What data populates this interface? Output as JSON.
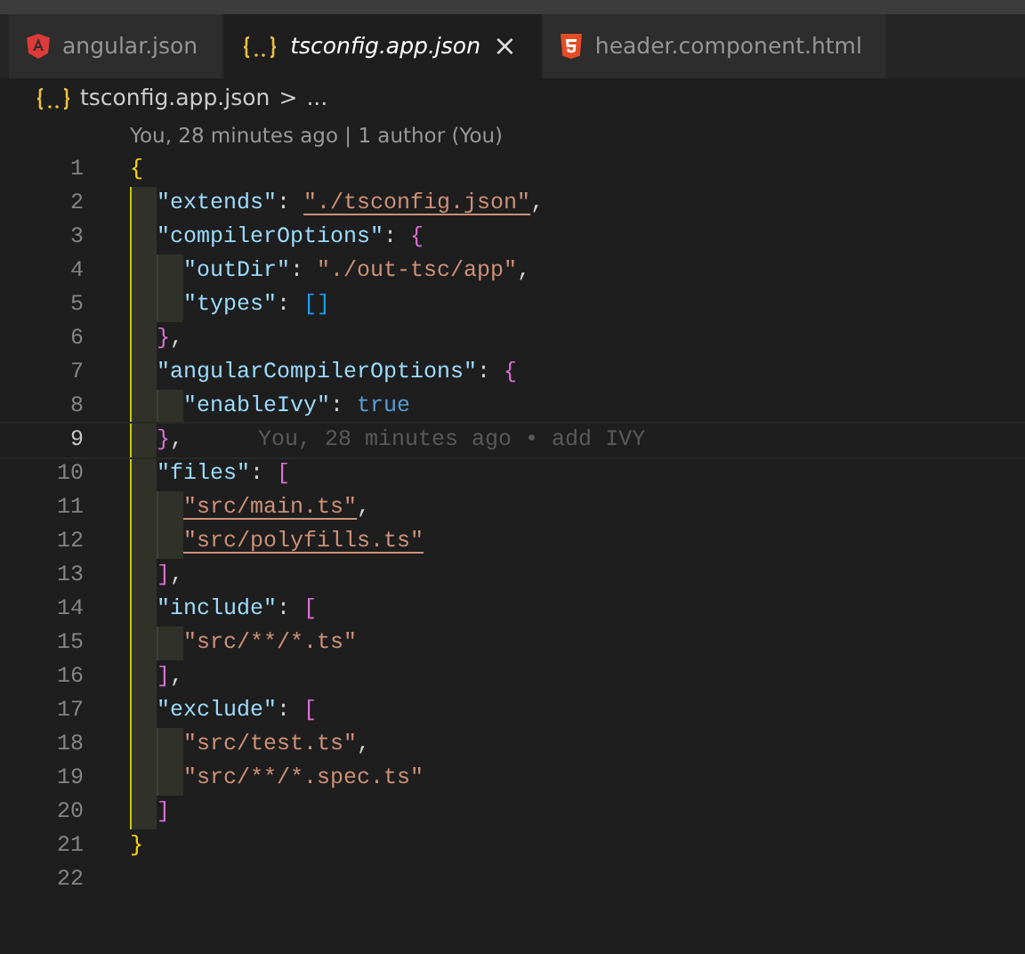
{
  "tabs": [
    {
      "label": "angular.json",
      "kind": "angular",
      "selected": false
    },
    {
      "label": "tsconfig.app.json",
      "kind": "json",
      "selected": true,
      "close": "×"
    },
    {
      "label": "header.component.html",
      "kind": "html",
      "selected": false
    }
  ],
  "breadcrumb": {
    "file": "tsconfig.app.json",
    "separator": ">",
    "more": "..."
  },
  "codelens": "You, 28 minutes ago | 1 author (You)",
  "lines": [
    {
      "number": "1",
      "current": false,
      "tokens": [
        {
          "kind": "bracket",
          "text": "{",
          "color": "#ffd700"
        }
      ]
    },
    {
      "number": "2",
      "current": false,
      "tokens": [
        {
          "kind": "key",
          "text": "  \"extends\""
        },
        {
          "kind": "punct",
          "text": ": "
        },
        {
          "kind": "string",
          "text": "\"./tsconfig.json\"",
          "underline": true
        },
        {
          "kind": "punct",
          "text": ","
        }
      ]
    },
    {
      "number": "3",
      "current": false,
      "tokens": [
        {
          "kind": "key",
          "text": "  \"compilerOptions\""
        },
        {
          "kind": "punct",
          "text": ": "
        },
        {
          "kind": "bracket",
          "text": "{",
          "color": "#da70d6"
        }
      ]
    },
    {
      "number": "4",
      "current": false,
      "tokens": [
        {
          "kind": "key",
          "text": "    \"outDir\""
        },
        {
          "kind": "punct",
          "text": ": "
        },
        {
          "kind": "string",
          "text": "\"./out-tsc/app\""
        },
        {
          "kind": "punct",
          "text": ","
        }
      ]
    },
    {
      "number": "5",
      "current": false,
      "tokens": [
        {
          "kind": "key",
          "text": "    \"types\""
        },
        {
          "kind": "punct",
          "text": ": "
        },
        {
          "kind": "bracket",
          "text": "[]",
          "color": "#179fff"
        }
      ]
    },
    {
      "number": "6",
      "current": false,
      "tokens": [
        {
          "kind": "bracket",
          "text": "  }",
          "color": "#da70d6"
        },
        {
          "kind": "punct",
          "text": ","
        }
      ]
    },
    {
      "number": "7",
      "current": false,
      "tokens": [
        {
          "kind": "key",
          "text": "  \"angularCompilerOptions\""
        },
        {
          "kind": "punct",
          "text": ": "
        },
        {
          "kind": "bracket",
          "text": "{",
          "color": "#da70d6"
        }
      ]
    },
    {
      "number": "8",
      "current": false,
      "tokens": [
        {
          "kind": "key",
          "text": "    \"enableIvy\""
        },
        {
          "kind": "punct",
          "text": ": "
        },
        {
          "kind": "bool",
          "text": "true"
        }
      ]
    },
    {
      "number": "9",
      "current": true,
      "blame": "You, 28 minutes ago • add IVY",
      "tokens": [
        {
          "kind": "bracket",
          "text": "  }",
          "color": "#da70d6"
        },
        {
          "kind": "punct",
          "text": ","
        }
      ]
    },
    {
      "number": "10",
      "current": false,
      "tokens": [
        {
          "kind": "key",
          "text": "  \"files\""
        },
        {
          "kind": "punct",
          "text": ": "
        },
        {
          "kind": "bracket",
          "text": "[",
          "color": "#da70d6"
        }
      ]
    },
    {
      "number": "11",
      "current": false,
      "tokens": [
        {
          "kind": "string",
          "text": "    \"src/main.ts\"",
          "underline": true
        },
        {
          "kind": "punct",
          "text": ","
        }
      ]
    },
    {
      "number": "12",
      "current": false,
      "tokens": [
        {
          "kind": "string",
          "text": "    \"src/polyfills.ts\"",
          "underline": true
        }
      ]
    },
    {
      "number": "13",
      "current": false,
      "tokens": [
        {
          "kind": "bracket",
          "text": "  ]",
          "color": "#da70d6"
        },
        {
          "kind": "punct",
          "text": ","
        }
      ]
    },
    {
      "number": "14",
      "current": false,
      "tokens": [
        {
          "kind": "key",
          "text": "  \"include\""
        },
        {
          "kind": "punct",
          "text": ": "
        },
        {
          "kind": "bracket",
          "text": "[",
          "color": "#da70d6"
        }
      ]
    },
    {
      "number": "15",
      "current": false,
      "tokens": [
        {
          "kind": "string",
          "text": "    \"src/**/*.ts\""
        }
      ]
    },
    {
      "number": "16",
      "current": false,
      "tokens": [
        {
          "kind": "bracket",
          "text": "  ]",
          "color": "#da70d6"
        },
        {
          "kind": "punct",
          "text": ","
        }
      ]
    },
    {
      "number": "17",
      "current": false,
      "tokens": [
        {
          "kind": "key",
          "text": "  \"exclude\""
        },
        {
          "kind": "punct",
          "text": ": "
        },
        {
          "kind": "bracket",
          "text": "[",
          "color": "#da70d6"
        }
      ]
    },
    {
      "number": "18",
      "current": false,
      "tokens": [
        {
          "kind": "string",
          "text": "    \"src/test.ts\""
        },
        {
          "kind": "punct",
          "text": ","
        }
      ]
    },
    {
      "number": "19",
      "current": false,
      "tokens": [
        {
          "kind": "string",
          "text": "    \"src/**/*.spec.ts\""
        }
      ]
    },
    {
      "number": "20",
      "current": false,
      "tokens": [
        {
          "kind": "bracket",
          "text": "  ]",
          "color": "#da70d6"
        }
      ]
    },
    {
      "number": "21",
      "current": false,
      "tokens": [
        {
          "kind": "bracket",
          "text": "}",
          "color": "#ffd700"
        }
      ]
    },
    {
      "number": "22",
      "current": false
    }
  ]
}
